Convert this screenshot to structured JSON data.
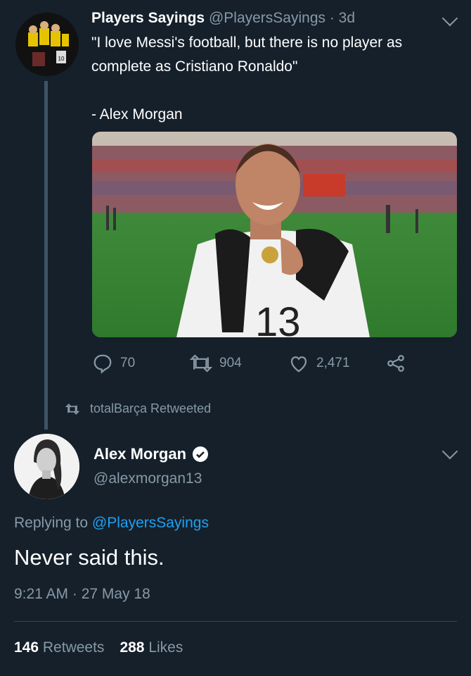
{
  "tweet": {
    "author_name": "Players Sayings",
    "author_handle": "@PlayersSayings",
    "age": "· 3d",
    "text": "\"I love Messi's football, but there is no player as\ncomplete as Cristiano Ronaldo\"\n\n- Alex Morgan",
    "jersey_number": "13",
    "avatar_badge": "10",
    "actions": {
      "replies": "70",
      "retweets": "904",
      "likes": "2,471"
    }
  },
  "retweet_context": {
    "label": "totalBarça Retweeted"
  },
  "reply": {
    "author_name": "Alex Morgan",
    "author_handle": "@alexmorgan13",
    "replying_prefix": "Replying to",
    "replying_handle": "@PlayersSayings",
    "text": "Never said this.",
    "timestamp": "9:21 AM · 27 May 18",
    "retweet_count": "146",
    "retweet_label": "Retweets",
    "like_count": "288",
    "like_label": "Likes"
  },
  "colors": {
    "background": "#15202b",
    "muted": "#8899a6",
    "accent": "#1da1f2",
    "thread_line": "#3d5466"
  },
  "icons": [
    "reply-icon",
    "retweet-icon",
    "like-icon",
    "share-icon",
    "chevron-down-icon",
    "verified-badge-icon"
  ]
}
